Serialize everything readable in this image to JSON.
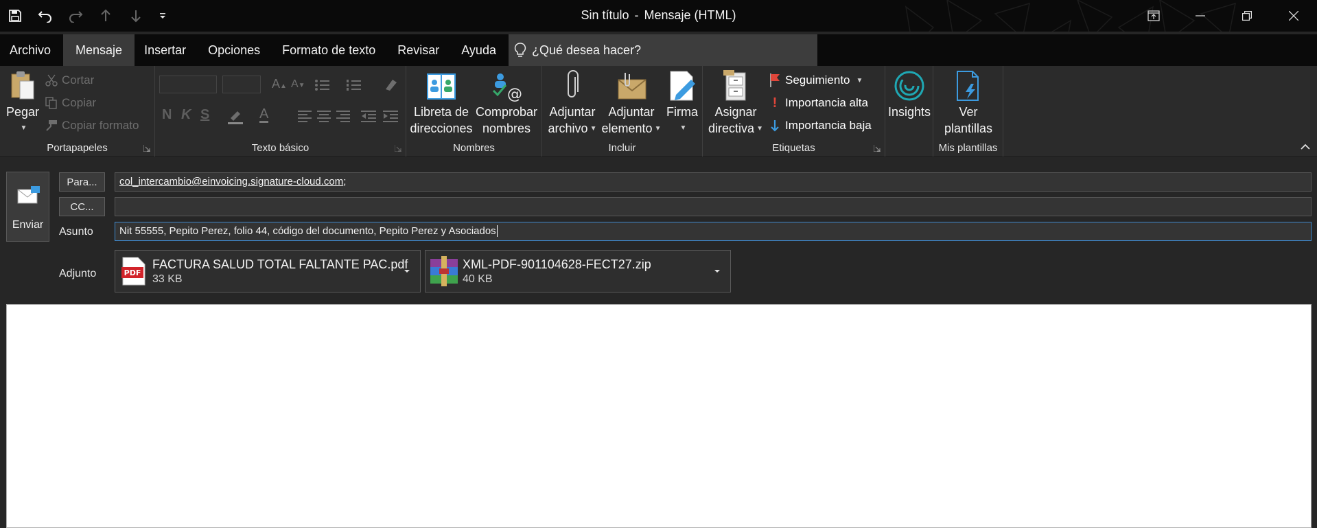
{
  "window": {
    "title": "Sin título",
    "separator": "-",
    "subtitle": "Mensaje (HTML)"
  },
  "quick_access": [
    "save-icon",
    "undo-icon",
    "redo-icon",
    "previous-item-icon",
    "next-item-icon",
    "customize-qat-icon"
  ],
  "tabs": [
    "Archivo",
    "Mensaje",
    "Insertar",
    "Opciones",
    "Formato de texto",
    "Revisar",
    "Ayuda"
  ],
  "active_tab": "Mensaje",
  "tellme": {
    "placeholder": "¿Qué desea hacer?"
  },
  "ribbon": {
    "clipboard": {
      "label": "Portapapeles",
      "paste": "Pegar",
      "cut": "Cortar",
      "copy": "Copiar",
      "format_painter": "Copiar formato"
    },
    "basic_text": {
      "label": "Texto básico"
    },
    "names": {
      "label": "Nombres",
      "address_book_1": "Libreta de",
      "address_book_2": "direcciones",
      "check_names_1": "Comprobar",
      "check_names_2": "nombres"
    },
    "include": {
      "label": "Incluir",
      "attach_file_1": "Adjuntar",
      "attach_file_2": "archivo",
      "attach_item_1": "Adjuntar",
      "attach_item_2": "elemento",
      "signature": "Firma"
    },
    "tags": {
      "label": "Etiquetas",
      "assign_1": "Asignar",
      "assign_2": "directiva",
      "follow_up": "Seguimiento",
      "high_importance": "Importancia alta",
      "low_importance": "Importancia baja"
    },
    "insights": {
      "label": "Insights"
    },
    "templates": {
      "label": "Mis plantillas",
      "view_1": "Ver",
      "view_2": "plantillas"
    }
  },
  "compose": {
    "send": "Enviar",
    "to_button": "Para...",
    "cc_button": "CC...",
    "subject_label": "Asunto",
    "attachments_label": "Adjunto",
    "to_value": "col_intercambio@einvoicing.signature-cloud.com",
    "to_suffix": ";",
    "cc_value": "",
    "subject_value": "Nit 55555, Pepito Perez, folio 44, código del documento, Pepito Perez y Asociados",
    "attachments": [
      {
        "name": "FACTURA SALUD TOTAL FALTANTE PAC.pdf",
        "size": "33 KB",
        "icon": "pdf-file-icon"
      },
      {
        "name": "XML-PDF-901104628-FECT27.zip",
        "size": "40 KB",
        "icon": "zip-archive-icon"
      }
    ]
  },
  "colors": {
    "titlebar": "#0a0a0a",
    "ribbon": "#2b2b2b",
    "active_tab": "#3a3a3a",
    "focus": "#3f8bd0",
    "accent_blue": "#3c9be0",
    "flag_red": "#e0463a"
  }
}
